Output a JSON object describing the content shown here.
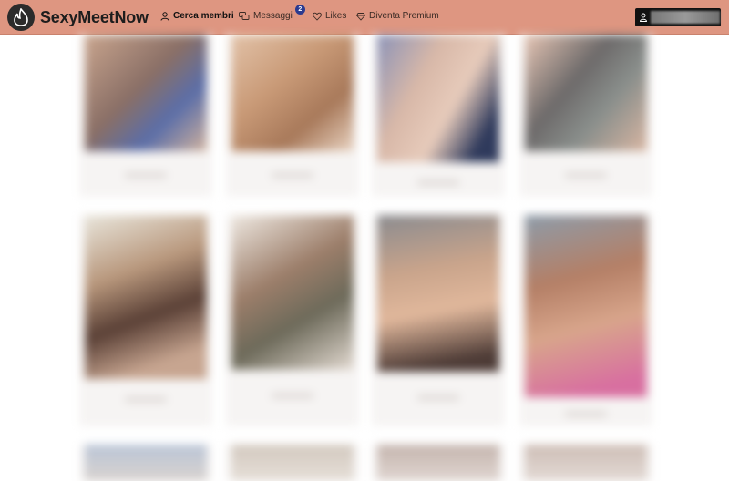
{
  "brand": {
    "name": "SexyMeetNow",
    "accent": "#de9681"
  },
  "nav": {
    "search_label": "Cerca membri",
    "messages_label": "Messaggi",
    "messages_badge": "2",
    "likes_label": "Likes",
    "premium_label": "Diventa Premium"
  },
  "icons": {
    "logo": "flame-icon",
    "search": "user-icon",
    "messages": "chat-bubbles-icon",
    "likes": "heart-icon",
    "premium": "diamond-icon",
    "account": "user-icon"
  },
  "members": [
    {
      "index": 1
    },
    {
      "index": 2
    },
    {
      "index": 3
    },
    {
      "index": 4
    },
    {
      "index": 5
    },
    {
      "index": 6
    },
    {
      "index": 7
    },
    {
      "index": 8
    },
    {
      "index": 9
    },
    {
      "index": 10
    },
    {
      "index": 11
    },
    {
      "index": 12
    }
  ]
}
